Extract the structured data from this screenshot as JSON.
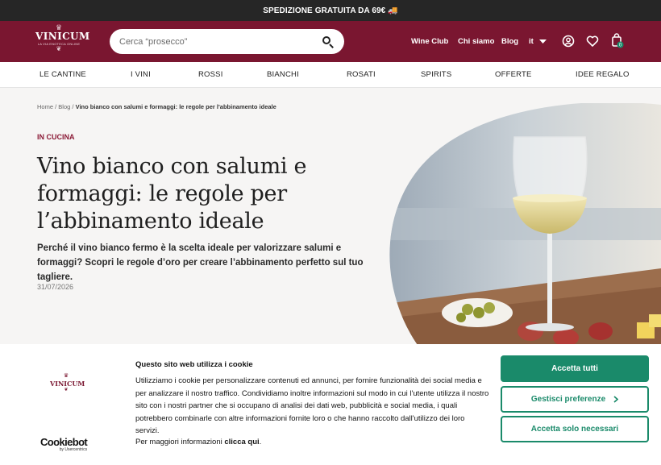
{
  "topbar": {
    "text": "SPEDIZIONE GRATUITA DA 69€ 🚚"
  },
  "logo": {
    "word": "VINICUM",
    "sub": "LA VIA ENOTECA ONLINE"
  },
  "search": {
    "placeholder": "Cerca “prosecco”"
  },
  "header_nav": {
    "wine_club": "Wine Club",
    "chi_siamo": "Chi siamo",
    "blog": "Blog",
    "lang": "it",
    "cart_count": "0"
  },
  "categories": [
    "LE CANTINE",
    "I VINI",
    "ROSSI",
    "BIANCHI",
    "ROSATI",
    "SPIRITS",
    "OFFERTE",
    "IDEE REGALO"
  ],
  "breadcrumb": {
    "home": "Home",
    "blog": "Blog",
    "current": "Vino bianco con salumi e formaggi: le regole per l'abbinamento ideale",
    "sep": "/"
  },
  "article": {
    "kicker": "IN CUCINA",
    "title": "Vino bianco con salumi e formaggi: le regole per l’abbinamento ideale",
    "lead": "Perché il vino bianco fermo è la scelta ideale per valorizzare salumi e formaggi? Scopri le regole d’oro per creare l’abbinamento perfetto sul tuo tagliere.",
    "date": "31/07/2026"
  },
  "cookie": {
    "logo_word": "VINICUM",
    "title": "Questo sito web utilizza i cookie",
    "body": "Utilizziamo i cookie per personalizzare contenuti ed annunci, per fornire funzionalità dei social media e per analizzare il nostro traffico. Condividiamo inoltre informazioni sul modo in cui l'utente utilizza il nostro sito con i nostri partner che si occupano di analisi dei dati web, pubblicità e social media, i quali potrebbero combinarle con altre informazioni fornite loro o che hanno raccolto dall'utilizzo dei loro servizi.",
    "more_prefix": "Per maggiori informazioni ",
    "more_link": "clicca qui",
    "more_suffix": ".",
    "accept_all": "Accetta tutti",
    "manage": "Gestisci preferenze",
    "accept_necessary": "Accetta solo necessari",
    "brand": "Cookiebot",
    "brand_by": "by Usercentrics"
  },
  "colors": {
    "brand": "#7a1630",
    "topbar": "#262626",
    "accent_green": "#1a8a6a"
  }
}
